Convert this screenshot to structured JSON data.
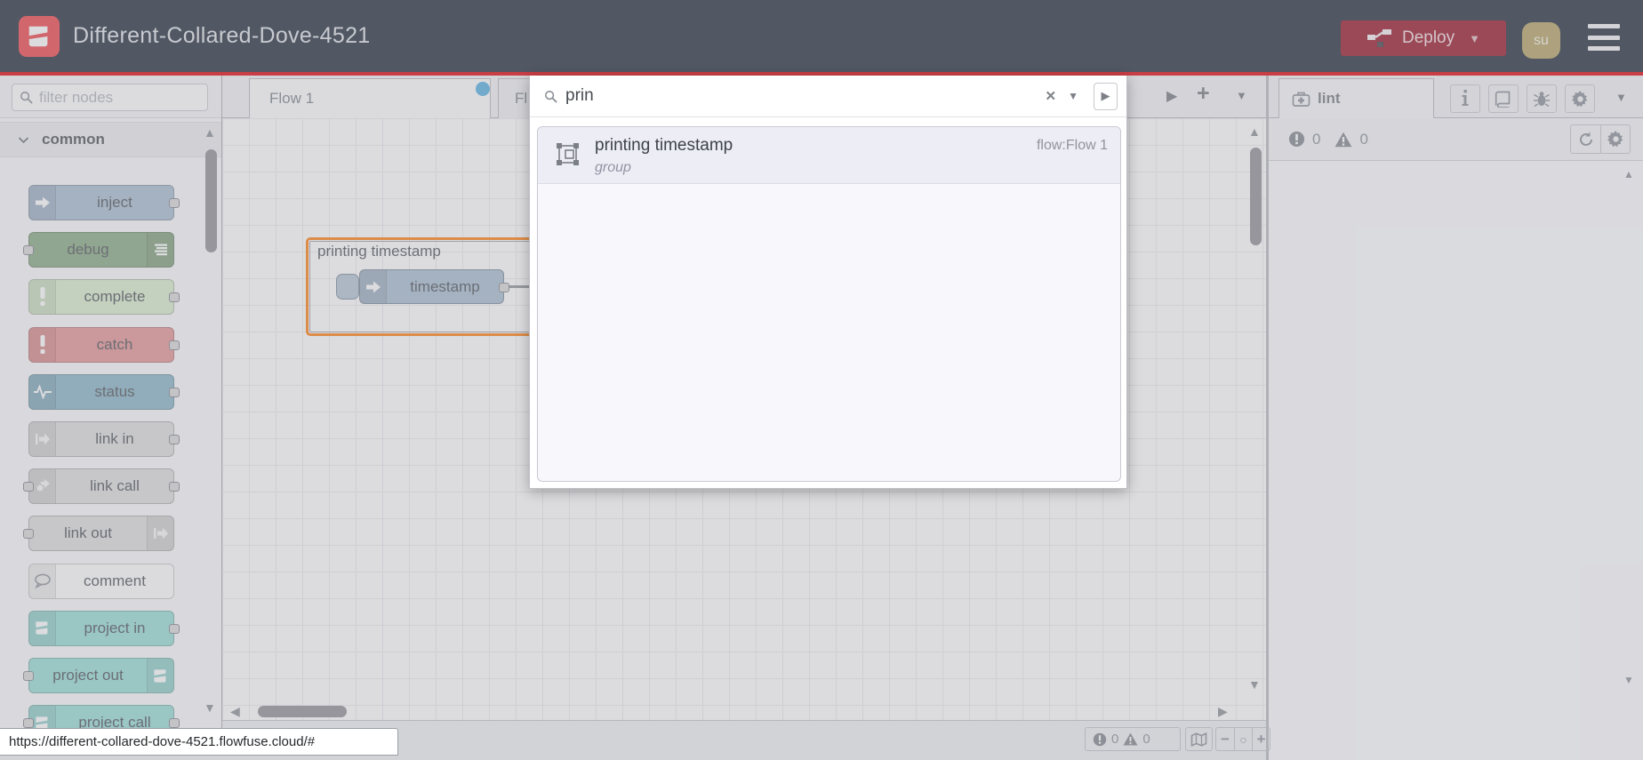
{
  "header": {
    "title": "Different-Collared-Dove-4521",
    "deploy_label": "Deploy",
    "avatar_initials": "su"
  },
  "palette": {
    "filter_placeholder": "filter nodes",
    "category_label": "common",
    "nodes": [
      {
        "label": "inject",
        "color": "#a6bbcf",
        "icon": "inject-arrow-icon",
        "icon_side": "left",
        "port_left": false,
        "port_right": true
      },
      {
        "label": "debug",
        "color": "#87a980",
        "icon": "debug-list-icon",
        "icon_side": "right",
        "port_left": true,
        "port_right": false
      },
      {
        "label": "complete",
        "color": "#d9edcb",
        "icon": "exclaim-icon",
        "icon_side": "left",
        "port_left": false,
        "port_right": true
      },
      {
        "label": "catch",
        "color": "#e49191",
        "icon": "exclaim-icon",
        "icon_side": "left",
        "port_left": false,
        "port_right": true
      },
      {
        "label": "status",
        "color": "#87b2c4",
        "icon": "status-wave-icon",
        "icon_side": "left",
        "port_left": false,
        "port_right": true
      },
      {
        "label": "link in",
        "color": "#dddddd",
        "icon": "link-arrow-icon",
        "icon_side": "left",
        "port_left": false,
        "port_right": true
      },
      {
        "label": "link call",
        "color": "#dddddd",
        "icon": "link-call-icon",
        "icon_side": "left",
        "port_left": true,
        "port_right": true
      },
      {
        "label": "link out",
        "color": "#dddddd",
        "icon": "link-arrow-icon",
        "icon_side": "right",
        "port_left": true,
        "port_right": false
      },
      {
        "label": "comment",
        "color": "#fdfdfd",
        "icon": "comment-bubble-icon",
        "icon_side": "left",
        "port_left": false,
        "port_right": false
      },
      {
        "label": "project in",
        "color": "#95dcd4",
        "icon": "project-mark-icon",
        "icon_side": "left",
        "port_left": false,
        "port_right": true
      },
      {
        "label": "project out",
        "color": "#95dcd4",
        "icon": "project-mark-icon",
        "icon_side": "right",
        "port_left": true,
        "port_right": false
      },
      {
        "label": "project call",
        "color": "#95dcd4",
        "icon": "project-mark-icon",
        "icon_side": "left",
        "port_left": true,
        "port_right": true
      }
    ]
  },
  "workspace": {
    "tab1_label": "Flow 1",
    "tab2_label_partial": "Fl",
    "add_tab_glyph": "+"
  },
  "canvas": {
    "group_label": "printing timestamp",
    "node_label": "timestamp"
  },
  "search": {
    "query": "prin",
    "result_title": "printing timestamp",
    "result_type": "group",
    "result_flow_ref": "flow:Flow 1"
  },
  "sidebar": {
    "tab_label": "lint",
    "error_count": "0",
    "warning_count": "0"
  },
  "canvas_footer": {
    "error_count": "0",
    "warning_count": "0"
  },
  "statusbar": {
    "url": "https://different-collared-dove-4521.flowfuse.cloud/#"
  },
  "colors": {
    "header_bg": "#1f2937",
    "accent_red": "#e00007",
    "deploy_red": "#971223",
    "logo_red": "#ee4347",
    "group_selected_border": "#ff7f0e",
    "unsaved_dot_blue": "#55aee0",
    "avatar_olive": "#b3a262"
  }
}
